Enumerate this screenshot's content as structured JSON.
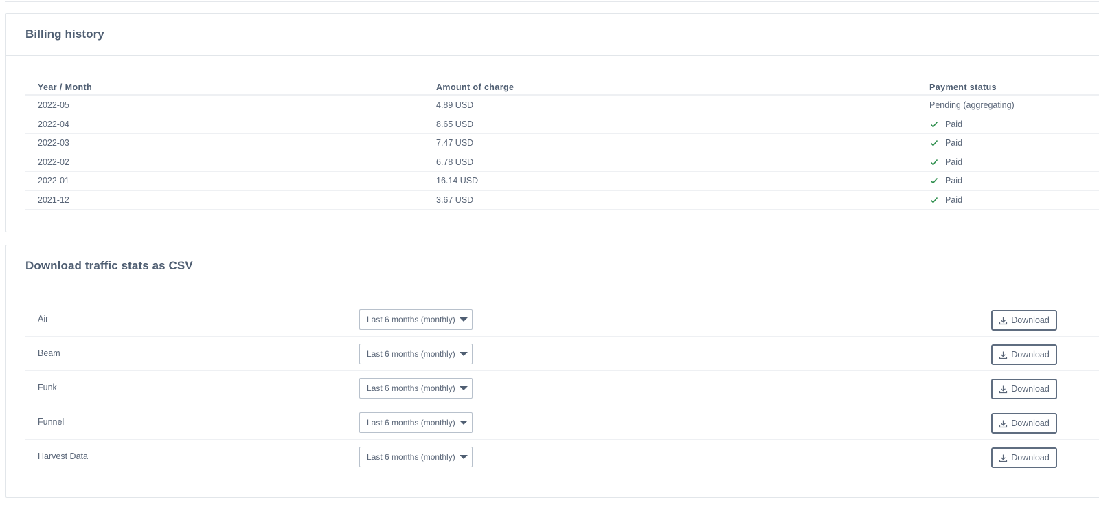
{
  "billing": {
    "title": "Billing history",
    "headers": {
      "year_month": "Year / Month",
      "amount": "Amount of charge",
      "status": "Payment status"
    },
    "rows": [
      {
        "period": "2022-05",
        "amount": "4.89 USD",
        "status": "Pending (aggregating)",
        "paid": false
      },
      {
        "period": "2022-04",
        "amount": "8.65 USD",
        "status": "Paid",
        "paid": true
      },
      {
        "period": "2022-03",
        "amount": "7.47 USD",
        "status": "Paid",
        "paid": true
      },
      {
        "period": "2022-02",
        "amount": "6.78 USD",
        "status": "Paid",
        "paid": true
      },
      {
        "period": "2022-01",
        "amount": "16.14 USD",
        "status": "Paid",
        "paid": true
      },
      {
        "period": "2021-12",
        "amount": "3.67 USD",
        "status": "Paid",
        "paid": true
      }
    ]
  },
  "traffic": {
    "title": "Download traffic stats as CSV",
    "rows": [
      {
        "name": "Air",
        "range": "Last 6 months (monthly)",
        "download_label": "Download"
      },
      {
        "name": "Beam",
        "range": "Last 6 months (monthly)",
        "download_label": "Download"
      },
      {
        "name": "Funk",
        "range": "Last 6 months (monthly)",
        "download_label": "Download"
      },
      {
        "name": "Funnel",
        "range": "Last 6 months (monthly)",
        "download_label": "Download"
      },
      {
        "name": "Harvest Data",
        "range": "Last 6 months (monthly)",
        "download_label": "Download"
      }
    ]
  },
  "icons": {
    "status_paid": "check-icon",
    "select_caret": "caret-down-icon",
    "download": "download-icon"
  },
  "colors": {
    "paid_green": "#2f8f4e",
    "title_text": "#4f5e72",
    "border": "#e2e6ea"
  }
}
